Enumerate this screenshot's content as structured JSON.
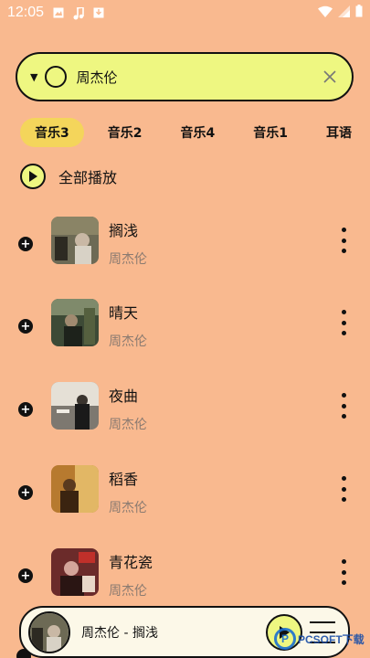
{
  "status_bar": {
    "time": "12:05",
    "left_icons": [
      "image-icon",
      "music-note-icon",
      "download-icon"
    ],
    "right_icons": [
      "wifi-icon",
      "signal-icon",
      "battery-icon"
    ]
  },
  "search": {
    "query": "周杰伦",
    "left_icons": [
      "dropdown-caret-icon",
      "circle-icon"
    ],
    "clear_icon": "close-icon"
  },
  "tabs": [
    {
      "label": "音乐3",
      "active": true
    },
    {
      "label": "音乐2",
      "active": false
    },
    {
      "label": "音乐4",
      "active": false
    },
    {
      "label": "音乐1",
      "active": false
    },
    {
      "label": "耳语",
      "active": false
    }
  ],
  "play_all": {
    "label": "全部播放",
    "icon": "play-icon"
  },
  "songs": [
    {
      "title": "搁浅",
      "artist": "周杰伦",
      "cover_colors": [
        "#6d6a55",
        "#c9b8a5",
        "#2d2a22"
      ]
    },
    {
      "title": "晴天",
      "artist": "周杰伦",
      "cover_colors": [
        "#3d4a36",
        "#7f8a6b",
        "#1d221b"
      ]
    },
    {
      "title": "夜曲",
      "artist": "周杰伦",
      "cover_colors": [
        "#7d7870",
        "#e5e0d6",
        "#1a1a1a"
      ]
    },
    {
      "title": "稻香",
      "artist": "周杰伦",
      "cover_colors": [
        "#b77a2f",
        "#e2b765",
        "#3b2410"
      ]
    },
    {
      "title": "青花瓷",
      "artist": "周杰伦",
      "cover_colors": [
        "#6b2b2a",
        "#d4a59a",
        "#2a1513"
      ]
    }
  ],
  "player": {
    "now_playing": "周杰伦 - 搁浅",
    "play_icon": "play-icon",
    "playlist_icon": "playlist-icon"
  },
  "watermark": {
    "text": "PCSOFT下载"
  },
  "colors": {
    "background": "#F9B98F",
    "accent_yellow": "#EEF781",
    "tab_active": "#F4D55B",
    "text": "#111111",
    "subtext": "#8A7A70"
  }
}
